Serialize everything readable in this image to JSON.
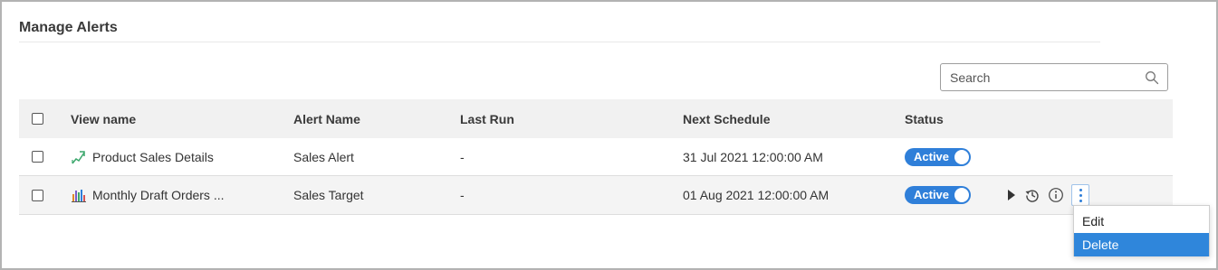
{
  "page": {
    "title": "Manage Alerts"
  },
  "search": {
    "placeholder": "Search",
    "value": ""
  },
  "table": {
    "columns": {
      "view_name": "View name",
      "alert_name": "Alert Name",
      "last_run": "Last Run",
      "next_schedule": "Next Schedule",
      "status": "Status"
    },
    "rows": [
      {
        "view_name": "Product Sales Details",
        "view_icon": "trend-arrow-icon",
        "alert_name": "Sales Alert",
        "last_run": "-",
        "next_schedule": "31 Jul 2021 12:00:00 AM",
        "status": "Active"
      },
      {
        "view_name": "Monthly Draft Orders ...",
        "view_icon": "bar-chart-icon",
        "alert_name": "Sales Target",
        "last_run": "-",
        "next_schedule": "01 Aug 2021 12:00:00 AM",
        "status": "Active"
      }
    ]
  },
  "menu": {
    "items": [
      "Edit",
      "Delete"
    ],
    "selected": "Delete"
  },
  "colors": {
    "accent": "#2f7fd9",
    "menu_selected": "#2f86db",
    "header_bg": "#f1f1f1"
  }
}
